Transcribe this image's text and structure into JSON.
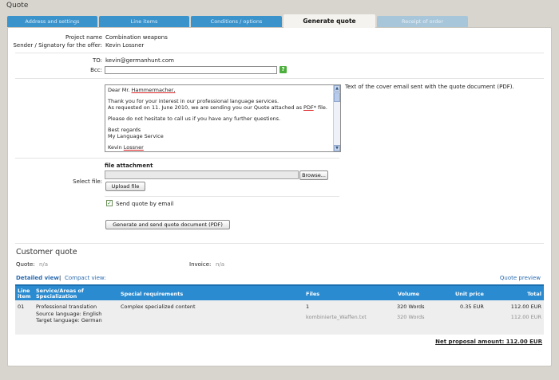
{
  "page": {
    "title": "Quote"
  },
  "tabs": [
    {
      "label": "Address and settings"
    },
    {
      "label": "Line items"
    },
    {
      "label": "Conditions / options"
    },
    {
      "label": "Generate quote"
    },
    {
      "label": "Receipt of order"
    }
  ],
  "project": {
    "name_label": "Project name",
    "name_value": "Combination weapons",
    "sender_label": "Sender / Signatory for the offer:",
    "sender_value": "Kevin Lossner"
  },
  "email": {
    "to_label": "TO:",
    "to_value": "kevin@germanhunt.com",
    "bcc_label": "Bcc:",
    "bcc_value": "",
    "help_icon": "?",
    "lines": {
      "greeting_pre": "Dear Mr. ",
      "greeting_name": "Hammermacher,",
      "l1": "Thank you for your interest in our professional language services.",
      "l2_pre": "As requested on 11. June 2010, we are sending you our Quote attached as ",
      "l2_pdf": "PDF",
      "l2_post": "* file.",
      "l3": "Please do not hesitate to call us if you have any further questions.",
      "l4": "Best regards",
      "l5": "My Language Service",
      "l6_pre": "Kevin ",
      "l6_name": "Lossner"
    },
    "help_text": "Text of the cover email sent with the quote document (PDF)."
  },
  "attachment": {
    "heading": "file attachment",
    "select_label": "Select file:",
    "browse_label": "Browse...",
    "upload_label": "Upload file",
    "send_checkbox_label": "Send quote by email",
    "send_checked": true,
    "generate_label": "Generate and send quote document (PDF)"
  },
  "customer_quote": {
    "title": "Customer quote",
    "quote_label": "Quote:",
    "quote_value": "n/a",
    "invoice_label": "Invoice:",
    "invoice_value": "n/a",
    "detailed_view": "Detailed view:",
    "view_sep": "|",
    "compact_view": "Compact view:",
    "quote_preview": "Quote preview"
  },
  "table": {
    "headers": {
      "line_item": [
        "Line",
        "item"
      ],
      "service": [
        "Service/Areas of",
        "Specialization"
      ],
      "requirements": "Special requirements",
      "files": "Files",
      "volume": "Volume",
      "unit_price": "Unit price",
      "total": "Total"
    },
    "rows": [
      {
        "line": "01",
        "service": "Professional translation",
        "source_lang": "Source language: English",
        "target_lang": "Target language:  German",
        "requirements": "Complex specialized content",
        "files": "1",
        "volume": "320 Words",
        "unit_price": "0.35 EUR",
        "total": "112.00 EUR",
        "file_name": "kombinierte_Waffen.txt",
        "file_volume": "320 Words",
        "file_total": "112.00 EUR"
      }
    ],
    "net_amount": "Net proposal amount: 112.00 EUR"
  }
}
